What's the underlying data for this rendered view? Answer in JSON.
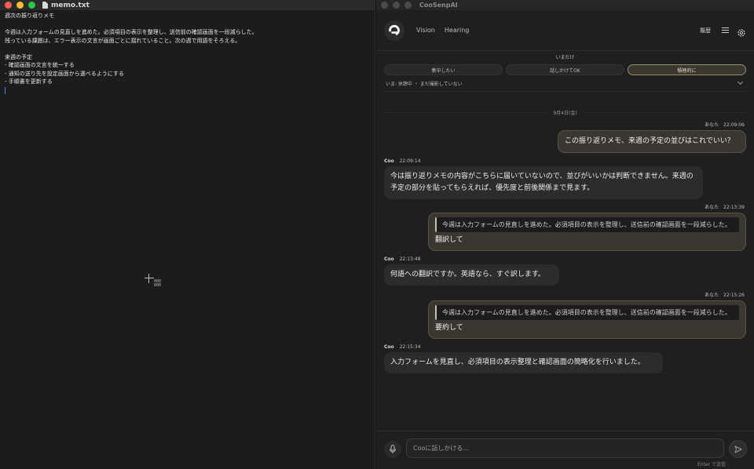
{
  "editor": {
    "file_name": "memo.txt",
    "lines": [
      "週次の振り返りメモ",
      "",
      "今週は入力フォームの見直しを進めた。必須項目の表示を整理し、送信前の確認画面を一段減らした。",
      "残っている課題は、エラー表示の文言が画面ごとに揺れていること。次の週で用語をそろえる。",
      "",
      "来週の予定",
      "- 確認画面の文言を統一する",
      "- 通知の送り先を設定画面から選べるようにする",
      "- 手順書を更新する"
    ],
    "cursor_readout": [
      "000",
      "000"
    ]
  },
  "app": {
    "window_title": "CooSenpAI",
    "nav": {
      "vision": "Vision",
      "hearing": "Hearing"
    },
    "history_label": "履歴",
    "mode": {
      "title": "いまだけ",
      "options": [
        "集中したい",
        "話しかけてOK",
        "積極的に"
      ],
      "selected": "積極的に"
    },
    "status_text": "いま: 休憩中 ・ まだ撮影していない",
    "date_label": "9月4日(金)",
    "messages": {
      "m1": {
        "author": "あなた",
        "time": "22:09:06",
        "text": "この振り返りメモ、来週の予定の並びはこれでいい？"
      },
      "m2": {
        "author": "Coo",
        "time": "22:09:14",
        "text": "今は振り返りメモの内容がこちらに届いていないので、並びがいいかは判断できません。来週の予定の部分を貼ってもらえれば、優先度と前後関係まで見ます。"
      },
      "m3": {
        "author": "あなた",
        "time": "22:13:39",
        "quote": "今週は入力フォームの見直しを進めた。必須項目の表示を整理し、送信前の確認画面を一段減らした。",
        "text": "翻訳して"
      },
      "m4": {
        "author": "Coo",
        "time": "22:13:48",
        "text": "何語への翻訳ですか。英語なら、すぐ訳します。"
      },
      "m5": {
        "author": "あなた",
        "time": "22:15:26",
        "quote": "今週は入力フォームの見直しを進めた。必須項目の表示を整理し、送信前の確認画面を一段減らした。",
        "text": "要約して"
      },
      "m6": {
        "author": "Coo",
        "time": "22:15:34",
        "text": "入力フォームを見直し、必須項目の表示整理と確認画面の簡略化を行いました。"
      }
    },
    "composer": {
      "placeholder": "Cooに話しかける...",
      "value": "",
      "hint": "Enter で送信"
    }
  },
  "colors": {
    "accent_border": "#9a8f6a",
    "user_bubble": "#3a3730",
    "assistant_bubble": "#2c2c2c"
  },
  "icons": [
    "document-icon",
    "app-logo-icon",
    "menu-icon",
    "gear-icon",
    "chevron-down-icon",
    "mic-icon",
    "send-icon",
    "crosshair-cursor-icon"
  ]
}
